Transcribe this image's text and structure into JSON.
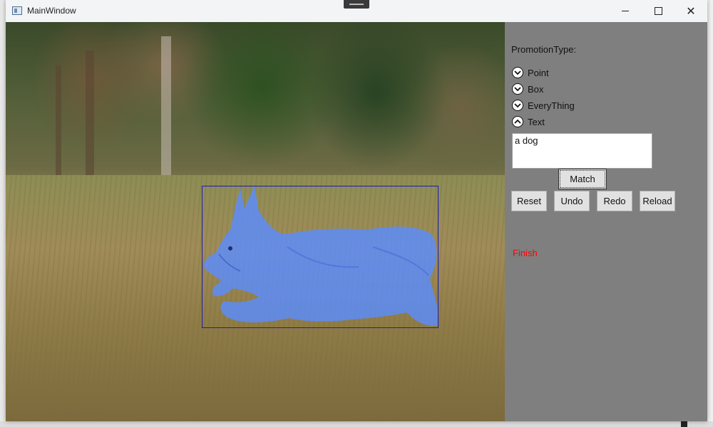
{
  "window": {
    "title": "MainWindow"
  },
  "controls": {
    "promotion_label": "PromotionType:",
    "options": [
      {
        "label": "Point",
        "icon": "chevron-down-icon"
      },
      {
        "label": "Box",
        "icon": "chevron-down-icon"
      },
      {
        "label": "EveryThing",
        "icon": "chevron-down-icon"
      },
      {
        "label": "Text",
        "icon": "chevron-up-icon"
      }
    ],
    "text_input_value": "a dog",
    "match_label": "Match",
    "buttons": {
      "reset": "Reset",
      "undo": "Undo",
      "redo": "Redo",
      "reload": "Reload"
    },
    "status": "Finish"
  },
  "colors": {
    "panel_bg": "#7f7f7f",
    "status_text": "#ff0000",
    "bbox_stroke": "#1c1cb8",
    "mask_fill": "#5a8cff"
  }
}
